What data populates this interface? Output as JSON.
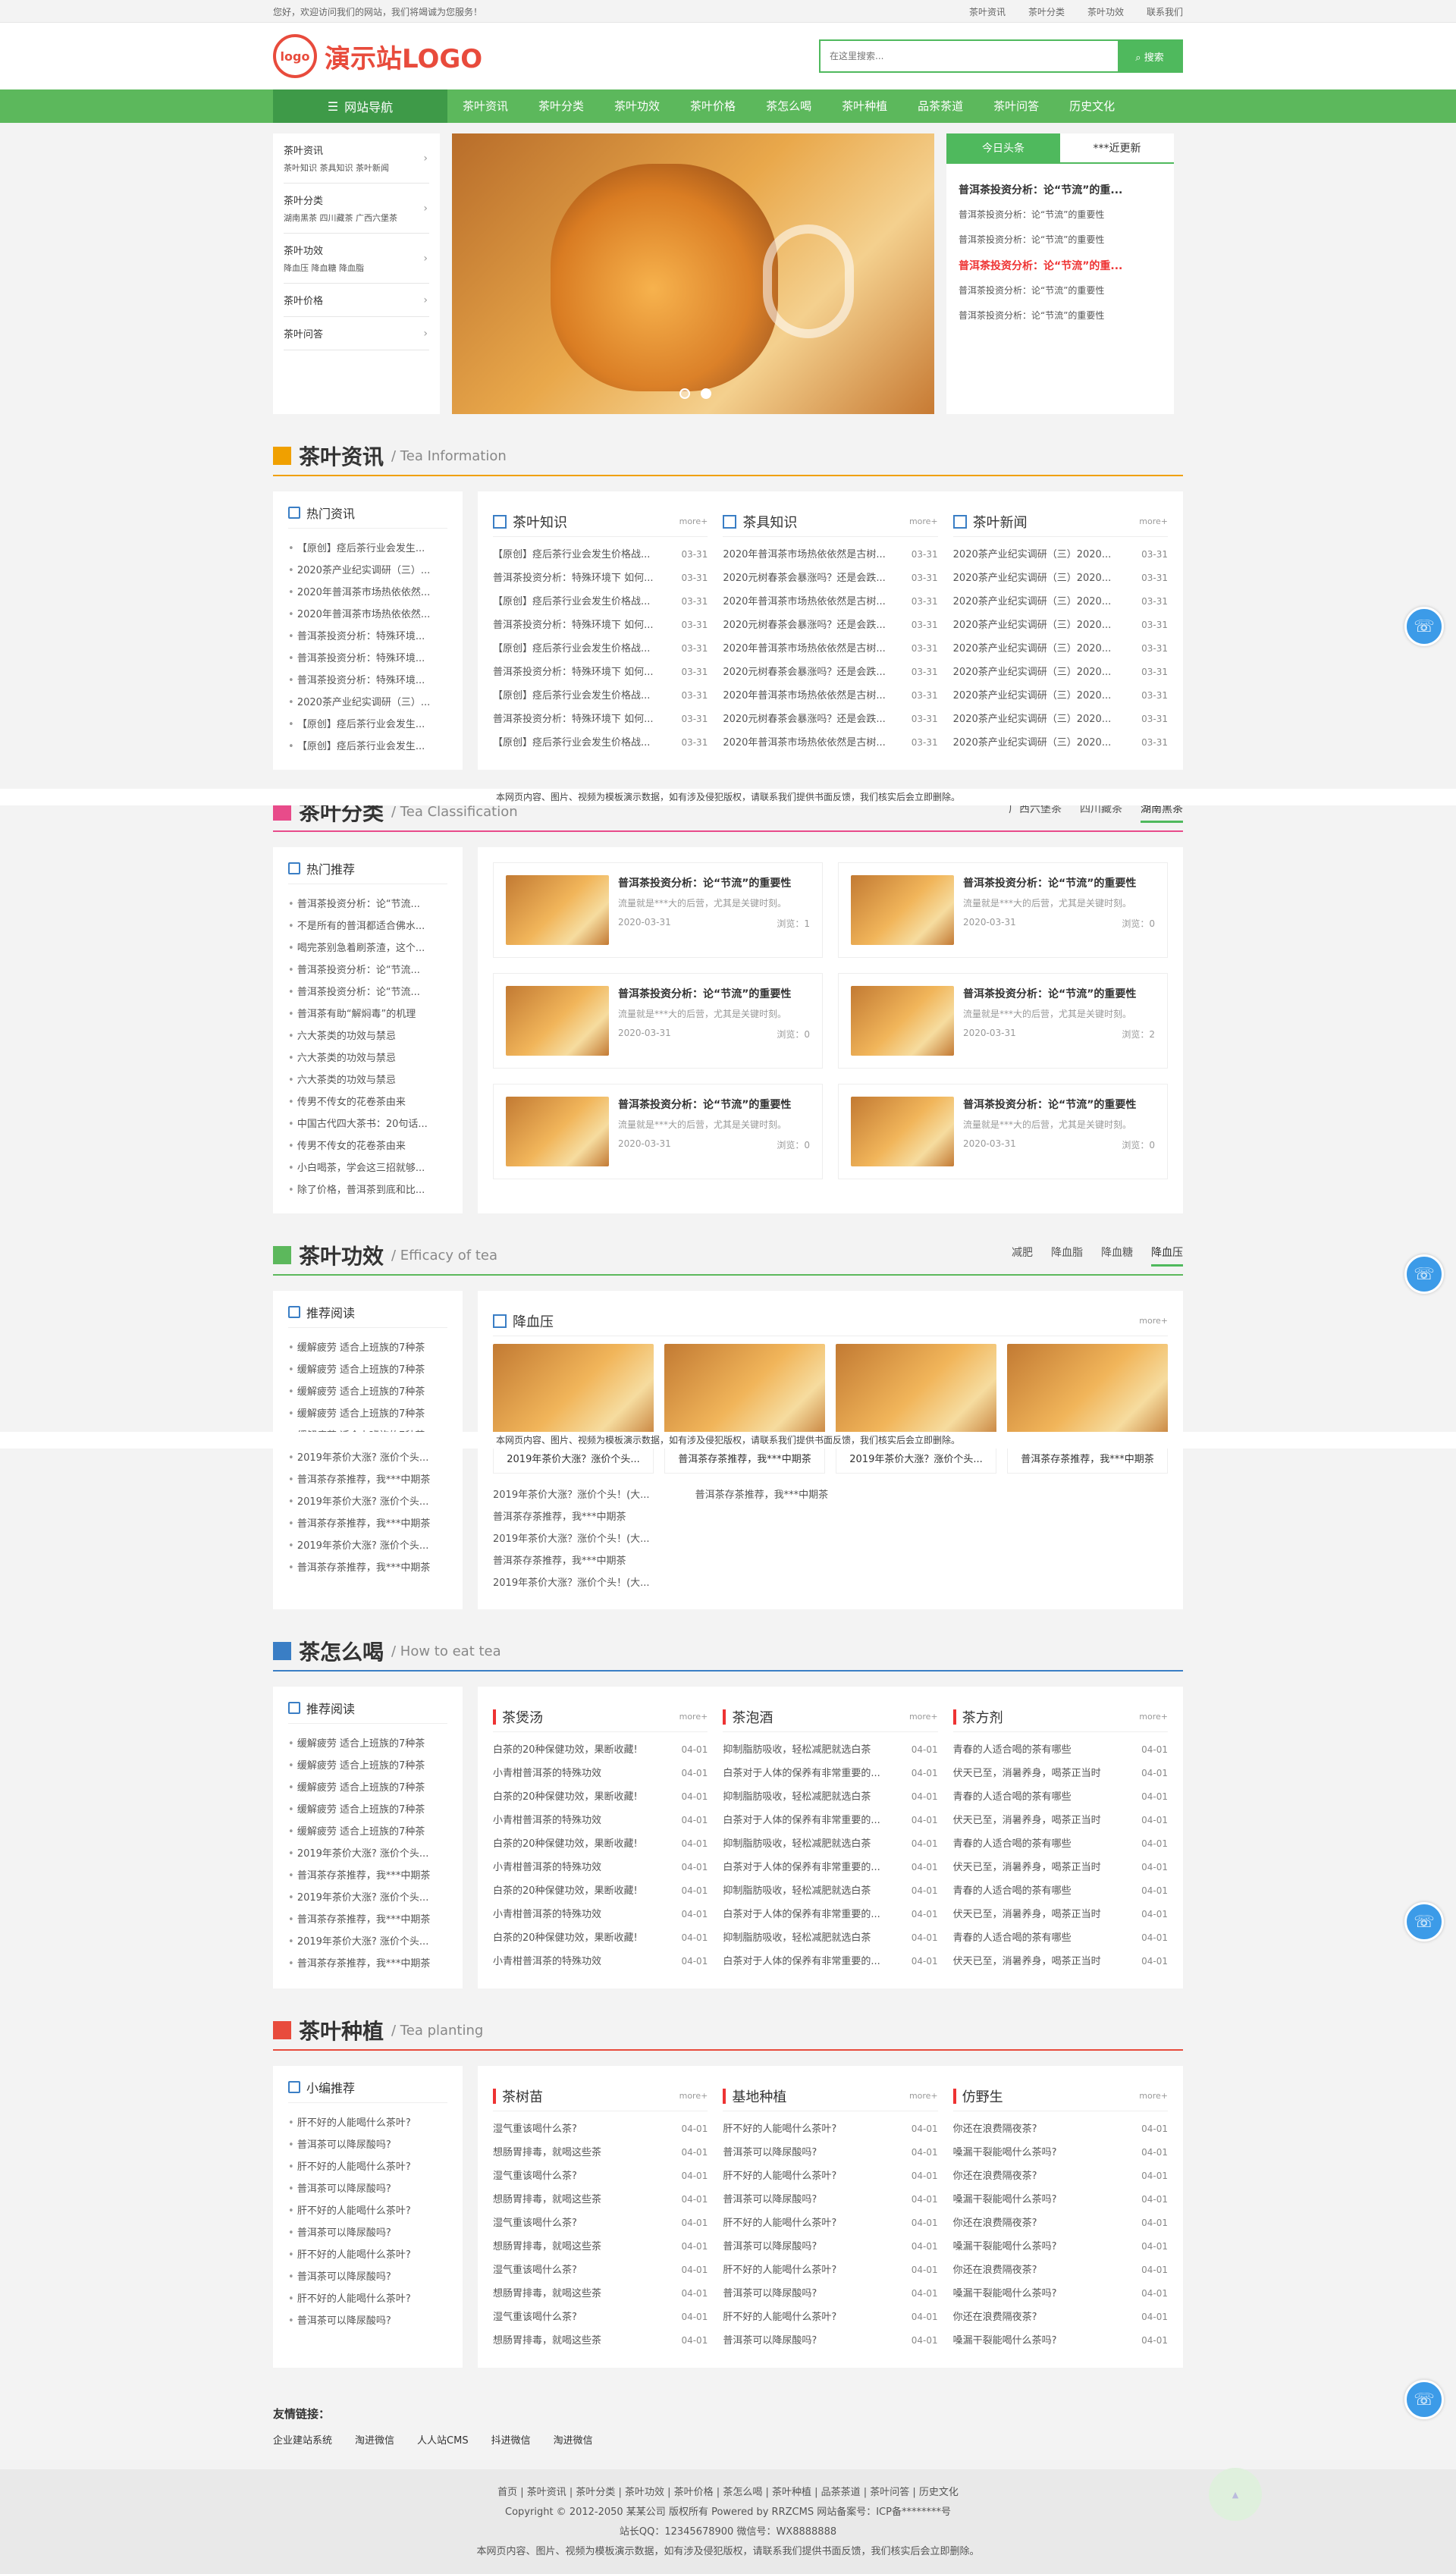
{
  "topbar": {
    "welcome": "您好，欢迎访问我们的网站，我们将竭诚为您服务！",
    "links": [
      "茶叶资讯",
      "茶叶分类",
      "茶叶功效",
      "联系我们"
    ]
  },
  "header": {
    "logo_badge": "logo",
    "logo_text": "演示站LOGO",
    "search_placeholder": "在这里搜索...",
    "search_button": "搜索"
  },
  "nav": {
    "guide": "网站导航",
    "items": [
      "茶叶资讯",
      "茶叶分类",
      "茶叶功效",
      "茶叶价格",
      "茶怎么喝",
      "茶叶种植",
      "品茶茶道",
      "茶叶问答",
      "历史文化"
    ]
  },
  "catmenu": [
    {
      "title": "茶叶资讯",
      "sub": "茶叶知识 茶具知识 茶叶新闻"
    },
    {
      "title": "茶叶分类",
      "sub": "湖南黑茶 四川藏茶 广西六堡茶"
    },
    {
      "title": "茶叶功效",
      "sub": "降血压 降血糖 降血脂"
    },
    {
      "title": "茶叶价格",
      "sub": ""
    },
    {
      "title": "茶叶问答",
      "sub": ""
    }
  ],
  "news_tabs": {
    "tab1": "今日头条",
    "tab2": "***近更新",
    "items": [
      {
        "text": "普洱茶投资分析：论“节流”的重...",
        "headline": true,
        "red": false
      },
      {
        "text": "普洱茶投资分析：论“节流”的重要性",
        "headline": false
      },
      {
        "text": "普洱茶投资分析：论“节流”的重要性",
        "headline": false
      },
      {
        "text": "普洱茶投资分析：论“节流”的重...",
        "headline": true,
        "red": true
      },
      {
        "text": "普洱茶投资分析：论“节流”的重要性",
        "headline": false
      },
      {
        "text": "普洱茶投资分析：论“节流”的重要性",
        "headline": false
      }
    ]
  },
  "notice": "本网页内容、图片、视频为模板演示数据，如有涉及侵犯版权，请联系我们提供书面反馈，我们核实后会立即删除。",
  "sec1": {
    "cn": "茶叶资讯",
    "en": "/ Tea Information",
    "side": {
      "title": "热门资讯",
      "items": [
        "【原创】痉后茶行业会发生...",
        "2020茶产业纪实调研（三）...",
        "2020年普洱茶市场热依依然...",
        "2020年普洱茶市场热依依然...",
        "普洱茶投资分析：特殊环境...",
        "普洱茶投资分析：特殊环境...",
        "普洱茶投资分析：特殊环境...",
        "2020茶产业纪实调研（三）...",
        "【原创】痉后茶行业会发生...",
        "【原创】痉后茶行业会发生..."
      ]
    },
    "cols": [
      {
        "title": "茶叶知识",
        "more": "more+",
        "rows": [
          [
            "【原创】痉后茶行业会发生价格战...",
            "03-31"
          ],
          [
            "普洱茶投资分析：特殊环境下 如何...",
            "03-31"
          ],
          [
            "【原创】痉后茶行业会发生价格战...",
            "03-31"
          ],
          [
            "普洱茶投资分析：特殊环境下 如何...",
            "03-31"
          ],
          [
            "【原创】痉后茶行业会发生价格战...",
            "03-31"
          ],
          [
            "普洱茶投资分析：特殊环境下 如何...",
            "03-31"
          ],
          [
            "【原创】痉后茶行业会发生价格战...",
            "03-31"
          ],
          [
            "普洱茶投资分析：特殊环境下 如何...",
            "03-31"
          ],
          [
            "【原创】痉后茶行业会发生价格战...",
            "03-31"
          ]
        ]
      },
      {
        "title": "茶具知识",
        "more": "more+",
        "rows": [
          [
            "2020年普洱茶市场热依依然是古树...",
            "03-31"
          ],
          [
            "2020元树春茶会暴涨吗？还是会跌...",
            "03-31"
          ],
          [
            "2020年普洱茶市场热依依然是古树...",
            "03-31"
          ],
          [
            "2020元树春茶会暴涨吗？还是会跌...",
            "03-31"
          ],
          [
            "2020年普洱茶市场热依依然是古树...",
            "03-31"
          ],
          [
            "2020元树春茶会暴涨吗？还是会跌...",
            "03-31"
          ],
          [
            "2020年普洱茶市场热依依然是古树...",
            "03-31"
          ],
          [
            "2020元树春茶会暴涨吗？还是会跌...",
            "03-31"
          ],
          [
            "2020年普洱茶市场热依依然是古树...",
            "03-31"
          ]
        ]
      },
      {
        "title": "茶叶新闻",
        "more": "more+",
        "rows": [
          [
            "2020茶产业纪实调研（三）2020...",
            "03-31"
          ],
          [
            "2020茶产业纪实调研（三）2020...",
            "03-31"
          ],
          [
            "2020茶产业纪实调研（三）2020...",
            "03-31"
          ],
          [
            "2020茶产业纪实调研（三）2020...",
            "03-31"
          ],
          [
            "2020茶产业纪实调研（三）2020...",
            "03-31"
          ],
          [
            "2020茶产业纪实调研（三）2020...",
            "03-31"
          ],
          [
            "2020茶产业纪实调研（三）2020...",
            "03-31"
          ],
          [
            "2020茶产业纪实调研（三）2020...",
            "03-31"
          ],
          [
            "2020茶产业纪实调研（三）2020...",
            "03-31"
          ]
        ]
      }
    ]
  },
  "sec2": {
    "cn": "茶叶分类",
    "en": "/ Tea Classification",
    "tabs": [
      "广西六堡茶",
      "四川藏茶",
      "湖南黑茶"
    ],
    "side": {
      "title": "热门推荐",
      "items": [
        "普洱茶投资分析：论“节流...",
        "不是所有的普洱都适合佛水...",
        "喝完茶别急着刷茶渣，这个...",
        "普洱茶投资分析：论“节流...",
        "普洱茶投资分析：论“节流...",
        "普洱茶有助“解焖毒”的机理",
        "六大茶类的功效与禁忌",
        "六大茶类的功效与禁忌",
        "六大茶类的功效与禁忌",
        "传男不传女的花卷茶由来",
        "中国古代四大茶书：20句话...",
        "传男不传女的花卷茶由来",
        "小白喝茶，学会这三招就够...",
        "除了价格，普洱茶到底和比..."
      ]
    },
    "products": [
      {
        "title": "普洱茶投资分析：论“节流”的重要性",
        "desc": "流量就是***大的后营，尤其是关键时刻。",
        "date": "2020-03-31",
        "views": "浏览：1"
      },
      {
        "title": "普洱茶投资分析：论“节流”的重要性",
        "desc": "流量就是***大的后营，尤其是关键时刻。",
        "date": "2020-03-31",
        "views": "浏览：0"
      },
      {
        "title": "普洱茶投资分析：论“节流”的重要性",
        "desc": "流量就是***大的后营，尤其是关键时刻。",
        "date": "2020-03-31",
        "views": "浏览：0"
      },
      {
        "title": "普洱茶投资分析：论“节流”的重要性",
        "desc": "流量就是***大的后营，尤其是关键时刻。",
        "date": "2020-03-31",
        "views": "浏览：2"
      },
      {
        "title": "普洱茶投资分析：论“节流”的重要性",
        "desc": "流量就是***大的后营，尤其是关键时刻。",
        "date": "2020-03-31",
        "views": "浏览：0"
      },
      {
        "title": "普洱茶投资分析：论“节流”的重要性",
        "desc": "流量就是***大的后营，尤其是关键时刻。",
        "date": "2020-03-31",
        "views": "浏览：0"
      }
    ]
  },
  "sec3": {
    "cn": "茶叶功效",
    "en": "/ Efficacy of tea",
    "tabs": [
      "减肥",
      "降血脂",
      "降血糖",
      "降血压"
    ],
    "side": {
      "title": "推荐阅读",
      "items": [
        "缓解疲劳 适合上班族的7种茶",
        "缓解疲劳 适合上班族的7种茶",
        "缓解疲劳 适合上班族的7种茶",
        "缓解疲劳 适合上班族的7种茶",
        "缓解疲劳 适合上班族的7种茶",
        "2019年茶价大涨? 涨价个头...",
        "普洱茶存茶推荐，我***中期茶",
        "2019年茶价大涨? 涨价个头...",
        "普洱茶存茶推荐，我***中期茶",
        "2019年茶价大涨? 涨价个头...",
        "普洱茶存茶推荐，我***中期茶"
      ]
    },
    "panel": {
      "title": "降血压",
      "more": "more+",
      "cards": [
        "2019年茶价大涨？涨价个头...",
        "普洱茶存茶推荐，我***中期茶",
        "2019年茶价大涨？涨价个头...",
        "普洱茶存茶推荐，我***中期茶"
      ],
      "list_a": [
        "2019年茶价大涨？涨价个头！(大...",
        "普洱茶存茶推荐，我***中期茶",
        "2019年茶价大涨？涨价个头！(大...",
        "普洱茶存茶推荐，我***中期茶",
        "2019年茶价大涨？涨价个头！(大..."
      ],
      "list_b": [
        "普洱茶存茶推荐，我***中期茶"
      ]
    }
  },
  "sec4": {
    "cn": "茶怎么喝",
    "en": "/ How to eat tea",
    "side": {
      "title": "推荐阅读",
      "items": [
        "缓解疲劳 适合上班族的7种茶",
        "缓解疲劳 适合上班族的7种茶",
        "缓解疲劳 适合上班族的7种茶",
        "缓解疲劳 适合上班族的7种茶",
        "缓解疲劳 适合上班族的7种茶",
        "2019年茶价大涨? 涨价个头...",
        "普洱茶存茶推荐，我***中期茶",
        "2019年茶价大涨? 涨价个头...",
        "普洱茶存茶推荐，我***中期茶",
        "2019年茶价大涨? 涨价个头...",
        "普洱茶存茶推荐，我***中期茶"
      ]
    },
    "cols": [
      {
        "title": "茶煲汤",
        "more": "more+",
        "rows": [
          [
            "白茶的20种保健功效，果断收藏!",
            "04-01"
          ],
          [
            "小青柑普洱茶的特殊功效",
            "04-01"
          ],
          [
            "白茶的20种保健功效，果断收藏!",
            "04-01"
          ],
          [
            "小青柑普洱茶的特殊功效",
            "04-01"
          ],
          [
            "白茶的20种保健功效，果断收藏!",
            "04-01"
          ],
          [
            "小青柑普洱茶的特殊功效",
            "04-01"
          ],
          [
            "白茶的20种保健功效，果断收藏!",
            "04-01"
          ],
          [
            "小青柑普洱茶的特殊功效",
            "04-01"
          ],
          [
            "白茶的20种保健功效，果断收藏!",
            "04-01"
          ],
          [
            "小青柑普洱茶的特殊功效",
            "04-01"
          ]
        ]
      },
      {
        "title": "茶泡酒",
        "more": "more+",
        "rows": [
          [
            "抑制脂肪吸收，轻松减肥就选白茶",
            "04-01"
          ],
          [
            "白茶对于人体的保养有非常重要的...",
            "04-01"
          ],
          [
            "抑制脂肪吸收，轻松减肥就选白茶",
            "04-01"
          ],
          [
            "白茶对于人体的保养有非常重要的...",
            "04-01"
          ],
          [
            "抑制脂肪吸收，轻松减肥就选白茶",
            "04-01"
          ],
          [
            "白茶对于人体的保养有非常重要的...",
            "04-01"
          ],
          [
            "抑制脂肪吸收，轻松减肥就选白茶",
            "04-01"
          ],
          [
            "白茶对于人体的保养有非常重要的...",
            "04-01"
          ],
          [
            "抑制脂肪吸收，轻松减肥就选白茶",
            "04-01"
          ],
          [
            "白茶对于人体的保养有非常重要的...",
            "04-01"
          ]
        ]
      },
      {
        "title": "茶方剂",
        "more": "more+",
        "rows": [
          [
            "青春的人适合喝的茶有哪些",
            "04-01"
          ],
          [
            "伏天已至，消暑养身，喝茶正当时",
            "04-01"
          ],
          [
            "青春的人适合喝的茶有哪些",
            "04-01"
          ],
          [
            "伏天已至，消暑养身，喝茶正当时",
            "04-01"
          ],
          [
            "青春的人适合喝的茶有哪些",
            "04-01"
          ],
          [
            "伏天已至，消暑养身，喝茶正当时",
            "04-01"
          ],
          [
            "青春的人适合喝的茶有哪些",
            "04-01"
          ],
          [
            "伏天已至，消暑养身，喝茶正当时",
            "04-01"
          ],
          [
            "青春的人适合喝的茶有哪些",
            "04-01"
          ],
          [
            "伏天已至，消暑养身，喝茶正当时",
            "04-01"
          ]
        ]
      }
    ]
  },
  "sec5": {
    "cn": "茶叶种植",
    "en": "/ Tea planting",
    "side": {
      "title": "小编推荐",
      "items": [
        "肝不好的人能喝什么茶叶?",
        "普洱茶可以降尿酸吗?",
        "肝不好的人能喝什么茶叶?",
        "普洱茶可以降尿酸吗?",
        "肝不好的人能喝什么茶叶?",
        "普洱茶可以降尿酸吗?",
        "肝不好的人能喝什么茶叶?",
        "普洱茶可以降尿酸吗?",
        "肝不好的人能喝什么茶叶?",
        "普洱茶可以降尿酸吗?"
      ]
    },
    "cols": [
      {
        "title": "茶树苗",
        "more": "more+",
        "rows": [
          [
            "湿气重该喝什么茶?",
            "04-01"
          ],
          [
            "想肠胃排毒，就喝这些茶",
            "04-01"
          ],
          [
            "湿气重该喝什么茶?",
            "04-01"
          ],
          [
            "想肠胃排毒，就喝这些茶",
            "04-01"
          ],
          [
            "湿气重该喝什么茶?",
            "04-01"
          ],
          [
            "想肠胃排毒，就喝这些茶",
            "04-01"
          ],
          [
            "湿气重该喝什么茶?",
            "04-01"
          ],
          [
            "想肠胃排毒，就喝这些茶",
            "04-01"
          ],
          [
            "湿气重该喝什么茶?",
            "04-01"
          ],
          [
            "想肠胃排毒，就喝这些茶",
            "04-01"
          ]
        ]
      },
      {
        "title": "基地种植",
        "more": "more+",
        "rows": [
          [
            "肝不好的人能喝什么茶叶?",
            "04-01"
          ],
          [
            "普洱茶可以降尿酸吗?",
            "04-01"
          ],
          [
            "肝不好的人能喝什么茶叶?",
            "04-01"
          ],
          [
            "普洱茶可以降尿酸吗?",
            "04-01"
          ],
          [
            "肝不好的人能喝什么茶叶?",
            "04-01"
          ],
          [
            "普洱茶可以降尿酸吗?",
            "04-01"
          ],
          [
            "肝不好的人能喝什么茶叶?",
            "04-01"
          ],
          [
            "普洱茶可以降尿酸吗?",
            "04-01"
          ],
          [
            "肝不好的人能喝什么茶叶?",
            "04-01"
          ],
          [
            "普洱茶可以降尿酸吗?",
            "04-01"
          ]
        ]
      },
      {
        "title": "仿野生",
        "more": "more+",
        "rows": [
          [
            "你还在浪费隔夜茶?",
            "04-01"
          ],
          [
            "嗓漏干裂能喝什么茶吗?",
            "04-01"
          ],
          [
            "你还在浪费隔夜茶?",
            "04-01"
          ],
          [
            "嗓漏干裂能喝什么茶吗?",
            "04-01"
          ],
          [
            "你还在浪费隔夜茶?",
            "04-01"
          ],
          [
            "嗓漏干裂能喝什么茶吗?",
            "04-01"
          ],
          [
            "你还在浪费隔夜茶?",
            "04-01"
          ],
          [
            "嗓漏干裂能喝什么茶吗?",
            "04-01"
          ],
          [
            "你还在浪费隔夜茶?",
            "04-01"
          ],
          [
            "嗓漏干裂能喝什么茶吗?",
            "04-01"
          ]
        ]
      }
    ]
  },
  "links": {
    "title": "友情链接：",
    "items": [
      "企业建站系统",
      "淘进微信",
      "人人站CMS",
      "抖进微信",
      "淘进微信"
    ]
  },
  "footer": {
    "nav": "首页 | 茶叶资讯 | 茶叶分类 | 茶叶功效 | 茶叶价格 | 茶怎么喝 | 茶叶种植 | 品茶茶道 | 茶叶问答 | 历史文化",
    "copy": "Copyright © 2012-2050 某某公司 版权所有 Powered by RRZCMS  网站备案号：ICP备********号",
    "contact": "站长QQ：12345678900 微信号：WX8888888"
  },
  "colors": {
    "brand_green": "#5cb85c",
    "logo_red": "#e84b3c"
  }
}
